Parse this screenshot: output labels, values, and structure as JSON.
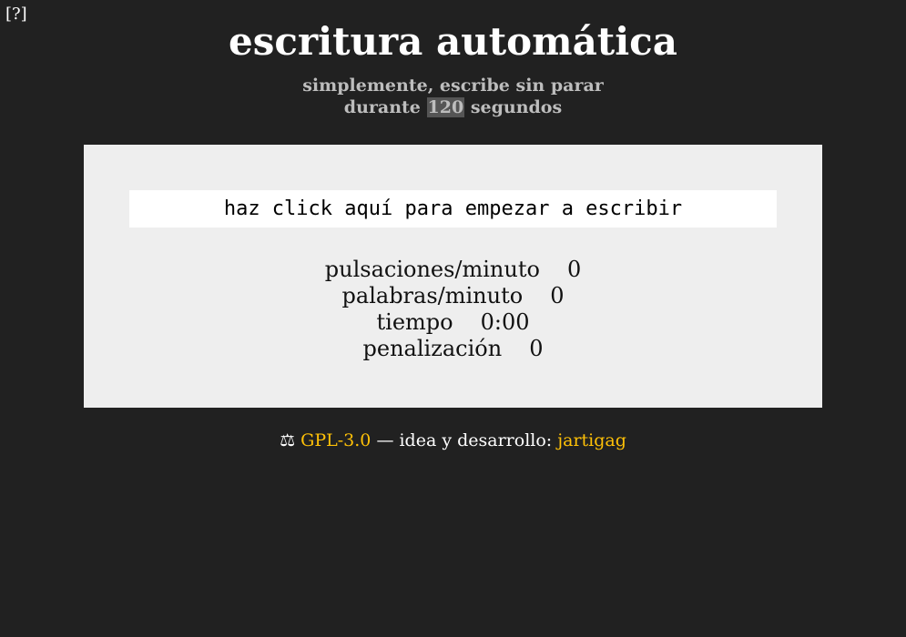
{
  "help": {
    "label": "[?]"
  },
  "header": {
    "title": "escritura automática",
    "subtitle_line1": "simplemente, escribe sin parar",
    "subtitle_prefix": "durante",
    "seconds": "120",
    "subtitle_suffix": "segundos"
  },
  "editor": {
    "prompt": "haz click aquí para empezar a escribir"
  },
  "stats": [
    {
      "label": "pulsaciones/minuto",
      "value": "0"
    },
    {
      "label": "palabras/minuto",
      "value": "0"
    },
    {
      "label": "tiempo",
      "value": "0:00"
    },
    {
      "label": "penalización",
      "value": "0"
    }
  ],
  "footer": {
    "icon": "scales-icon",
    "icon_glyph": "⚖",
    "license": "GPL-3.0",
    "separator": "— idea y desarrollo:",
    "author": "jartigag"
  },
  "colors": {
    "background": "#212121",
    "panel": "#eeeeee",
    "link": "#ffc107",
    "subtitle": "#bdbdbd",
    "seconds_highlight": "#555555"
  }
}
